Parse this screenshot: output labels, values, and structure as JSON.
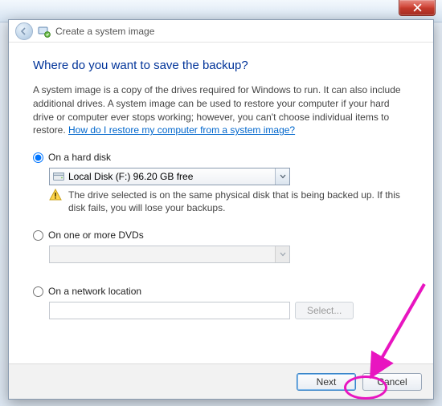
{
  "header": {
    "title": "Create a system image"
  },
  "heading": "Where do you want to save the backup?",
  "description": {
    "text": "A system image is a copy of the drives required for Windows to run. It can also include additional drives. A system image can be used to restore your computer if your hard drive or computer ever stops working; however, you can't choose individual items to restore. ",
    "link": "How do I restore my computer from a system image?"
  },
  "options": {
    "hard_disk": {
      "label": "On a hard disk",
      "selected": "Local Disk (F:)  96.20 GB free",
      "warning": "The drive selected is on the same physical disk that is being backed up. If this disk fails, you will lose your backups."
    },
    "dvd": {
      "label": "On one or more DVDs",
      "selected": ""
    },
    "network": {
      "label": "On a network location",
      "value": "",
      "select_btn": "Select..."
    }
  },
  "footer": {
    "next": "Next",
    "cancel": "Cancel"
  }
}
